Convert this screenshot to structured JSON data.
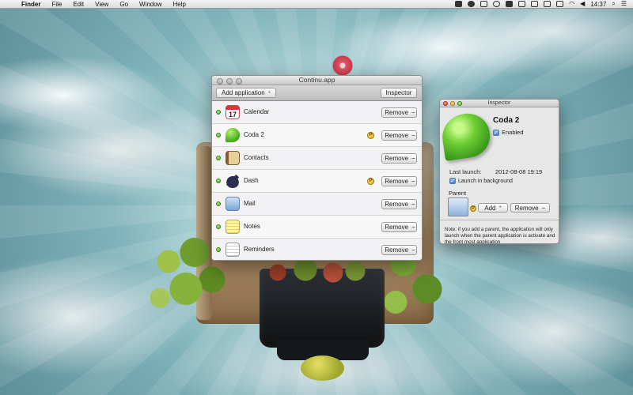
{
  "menubar": {
    "apple_glyph": "",
    "items": [
      "Finder",
      "File",
      "Edit",
      "View",
      "Go",
      "Window",
      "Help"
    ],
    "status_icons": [
      "status-icon-a",
      "cat-icon",
      "status-icon-b",
      "q-icon",
      "dropbox-icon",
      "box-icon",
      "status-icon-c",
      "display-icon",
      "battery-icon",
      "wifi-icon",
      "volume-icon"
    ],
    "clock": "14:37",
    "search_glyph": "⌕",
    "list_glyph": "☰"
  },
  "main_window": {
    "title": "Continu.app",
    "add_application_label": "Add application",
    "inspector_label": "Inspector",
    "remove_label": "Remove",
    "minus_glyph": "−",
    "stepper_glyph": "÷",
    "badge_letter": "P",
    "apps": [
      {
        "name": "Calendar",
        "icon": "calendar-icon",
        "badge": false
      },
      {
        "name": "Coda 2",
        "icon": "coda-icon",
        "badge": true
      },
      {
        "name": "Contacts",
        "icon": "contacts-icon",
        "badge": false
      },
      {
        "name": "Dash",
        "icon": "dash-icon",
        "badge": true
      },
      {
        "name": "Mail",
        "icon": "mail-icon",
        "badge": false
      },
      {
        "name": "Notes",
        "icon": "notes-icon",
        "badge": false
      },
      {
        "name": "Reminders",
        "icon": "reminders-icon",
        "badge": false
      }
    ],
    "calendar_day": "17"
  },
  "inspector": {
    "title": "Inspector",
    "app_name": "Coda 2",
    "enabled_label": "Enabled",
    "enabled_checked": true,
    "last_launch_label": "Last launch:",
    "last_launch_value": "2012-08-08 19:19",
    "launch_bg_label": "Launch in background",
    "launch_bg_checked": true,
    "parent_label": "Parent",
    "add_label": "Add",
    "remove_label": "Remove",
    "check_glyph": "✓",
    "badge_letter": "P",
    "note": "Note: if you add a parent, the application will only launch when the parent application is activate and the front most application"
  }
}
